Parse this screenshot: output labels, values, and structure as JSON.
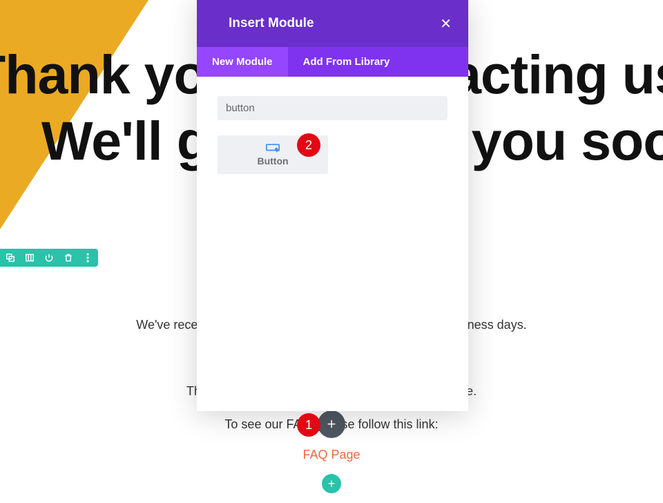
{
  "hero": {
    "line1": "Thank you for contacting us!",
    "line2": "We'll get back to you soon."
  },
  "toolbar": {
    "icons": [
      "layers-icon",
      "columns-icon",
      "power-icon",
      "trash-icon",
      "more-icon"
    ]
  },
  "body": {
    "line1": "We've received your message and will respond within 3 business days.",
    "line2": "This page will answer most questions you may have.",
    "line3": "To see our FAQ, please follow this link:",
    "faq_label": "FAQ Page"
  },
  "modal": {
    "title": "Insert Module",
    "tabs": {
      "new": "New Module",
      "library": "Add From Library"
    },
    "search_value": "button",
    "module": {
      "label": "Button"
    }
  },
  "annotations": {
    "b1": "1",
    "b2": "2"
  },
  "fab": {
    "plus": "+",
    "plus2": "+"
  }
}
